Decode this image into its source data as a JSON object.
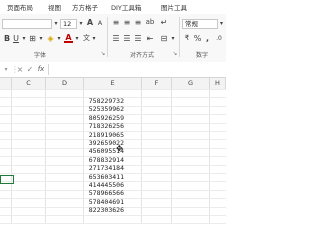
{
  "ribbon": {
    "tabs": [
      "页面布局",
      "视图",
      "方方格子",
      "DIY工具箱",
      "图片工具"
    ],
    "font_size": "12",
    "number_format": "常规",
    "groups": {
      "font": "字体",
      "alignment": "对齐方式",
      "number": "数字"
    },
    "icons": {
      "bold": "B",
      "underline": "U",
      "grow_font": "A",
      "shrink_font": "A",
      "percent": "%",
      "thousands": ","
    }
  },
  "formula_bar": {
    "cancel": "×",
    "enter": "✓",
    "fx": "fx",
    "value": ""
  },
  "columns": [
    "C",
    "D",
    "E",
    "F",
    "G",
    "H"
  ],
  "cells": [
    "758229732",
    "525359962",
    "805926259",
    "718326256",
    "218919065",
    "392659022",
    "456095514",
    "678832914",
    "271734184",
    "653603411",
    "414445506",
    "578966566",
    "578404691",
    "822303626"
  ]
}
